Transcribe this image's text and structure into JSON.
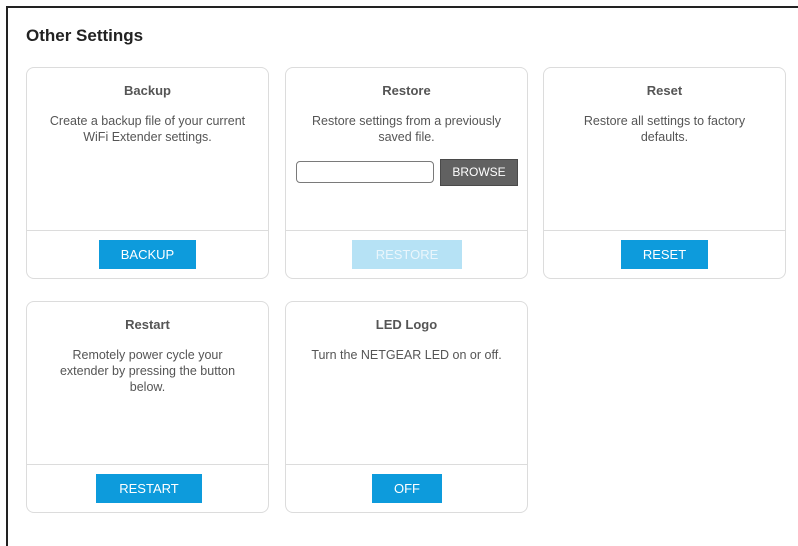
{
  "page": {
    "title": "Other Settings"
  },
  "cards": {
    "backup": {
      "title": "Backup",
      "description": "Create a backup file of your current WiFi Extender settings.",
      "button": "BACKUP"
    },
    "restore": {
      "title": "Restore",
      "description": "Restore settings from a previously saved file.",
      "file_value": "",
      "browse": "BROWSE",
      "button": "RESTORE",
      "button_state": "disabled"
    },
    "reset": {
      "title": "Reset",
      "description": "Restore all settings to factory defaults.",
      "button": "RESET"
    },
    "restart": {
      "title": "Restart",
      "description": "Remotely power cycle your extender by pressing the button below.",
      "button": "RESTART"
    },
    "led": {
      "title": "LED Logo",
      "description": "Turn the NETGEAR LED on or off.",
      "button": "OFF"
    }
  },
  "colors": {
    "primary_button": "#0d9bdc",
    "disabled_button": "#b6e2f5",
    "browse_button": "#616161"
  }
}
